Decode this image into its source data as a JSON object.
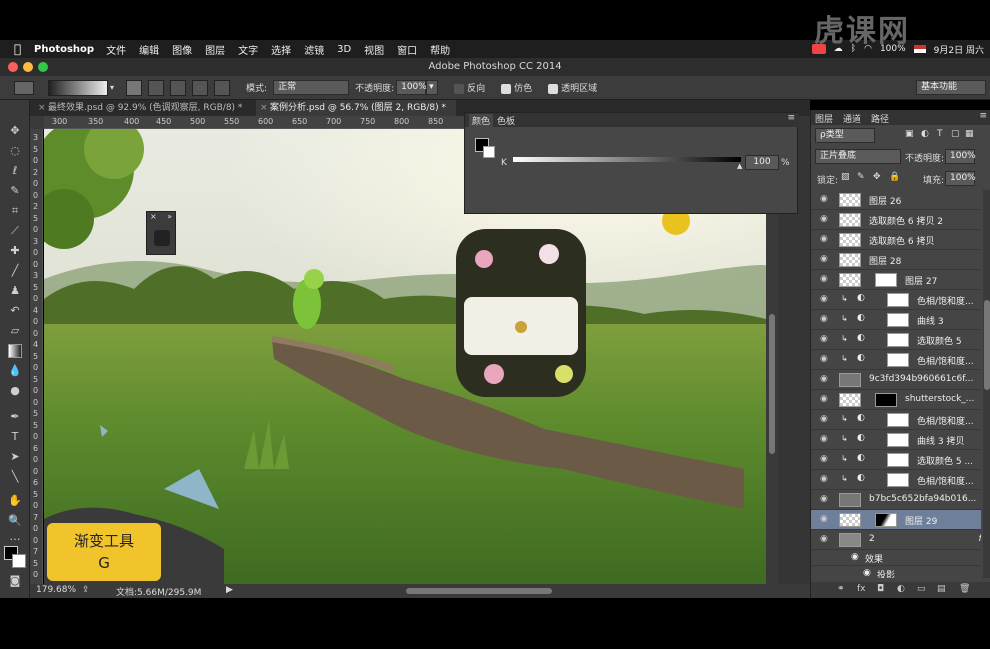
{
  "menubar": {
    "app_name": "Photoshop",
    "items": [
      "文件",
      "编辑",
      "图像",
      "图层",
      "文字",
      "选择",
      "滤镜",
      "3D",
      "视图",
      "窗口",
      "帮助"
    ],
    "battery": "100%",
    "date": "9月2日 周六",
    "watermark": "虎课网"
  },
  "window": {
    "title": "Adobe Photoshop CC 2014"
  },
  "options": {
    "mode_label": "模式:",
    "mode_value": "正常",
    "opacity_label": "不透明度:",
    "opacity_value": "100%",
    "reverse_label": "反向",
    "dither_label": "仿色",
    "transparency_label": "透明区域",
    "workspace": "基本功能"
  },
  "tabs": [
    {
      "label": "最终效果.psd @ 92.9% (色调观察层, RGB/8) *"
    },
    {
      "label": "案例分析.psd @ 56.7% (图层 2, RGB/8) *"
    }
  ],
  "ruler": {
    "h": [
      "300",
      "350",
      "400",
      "450",
      "500",
      "550",
      "600",
      "650",
      "700",
      "750",
      "800",
      "850"
    ],
    "v": [
      "3",
      "5",
      "0",
      "2",
      "0",
      "0",
      "2",
      "5",
      "0",
      "3",
      "0",
      "0",
      "3",
      "5",
      "0",
      "4",
      "0",
      "0",
      "4",
      "5",
      "0",
      "5",
      "0",
      "0",
      "5",
      "5",
      "0",
      "6",
      "0",
      "0",
      "6",
      "5",
      "0",
      "7",
      "0",
      "0",
      "7",
      "5",
      "0"
    ]
  },
  "color_panel": {
    "tabs": [
      "颜色",
      "色板"
    ],
    "channel": "K",
    "value": "100",
    "unit": "%"
  },
  "status": {
    "zoom": "179.68%",
    "doc": "文档:5.66M/295.9M"
  },
  "tooltip": {
    "line1": "渐变工具",
    "line2": "G"
  },
  "layers": {
    "tabs": [
      "图层",
      "通道",
      "路径"
    ],
    "filter_label": "ρ类型",
    "blend_mode": "正片叠底",
    "opacity_label": "不透明度:",
    "opacity_value": "100%",
    "lock_label": "锁定:",
    "fill_label": "填充:",
    "fill_value": "100%",
    "rows": [
      {
        "name": "图层 26",
        "type": "plain"
      },
      {
        "name": "选取颜色 6 拷贝 2",
        "type": "plain"
      },
      {
        "name": "选取颜色 6 拷贝",
        "type": "plain"
      },
      {
        "name": "图层 28",
        "type": "plain"
      },
      {
        "name": "图层 27",
        "type": "linked"
      },
      {
        "name": "色相/饱和度...",
        "type": "adj"
      },
      {
        "name": "曲线 3",
        "type": "adj"
      },
      {
        "name": "选取颜色 5",
        "type": "adj"
      },
      {
        "name": "色相/饱和度...",
        "type": "adj"
      },
      {
        "name": "9c3fd394b960661c6f...",
        "type": "smart"
      },
      {
        "name": "shutterstock_...",
        "type": "masked"
      },
      {
        "name": "色相/饱和度...",
        "type": "adj"
      },
      {
        "name": "曲线 3 拷贝",
        "type": "adj"
      },
      {
        "name": "选取颜色 5 ...",
        "type": "adj"
      },
      {
        "name": "色相/饱和度...",
        "type": "adj"
      },
      {
        "name": "b7bc5c652bfa94b016...",
        "type": "smart"
      },
      {
        "name": "图层 29",
        "type": "selected"
      },
      {
        "name": "2",
        "type": "group"
      }
    ],
    "effects_label": "效果",
    "shadow_label": "投影"
  },
  "colors": {
    "accent_tip": "#f2c42c",
    "selected_layer": "#6e7f99"
  }
}
